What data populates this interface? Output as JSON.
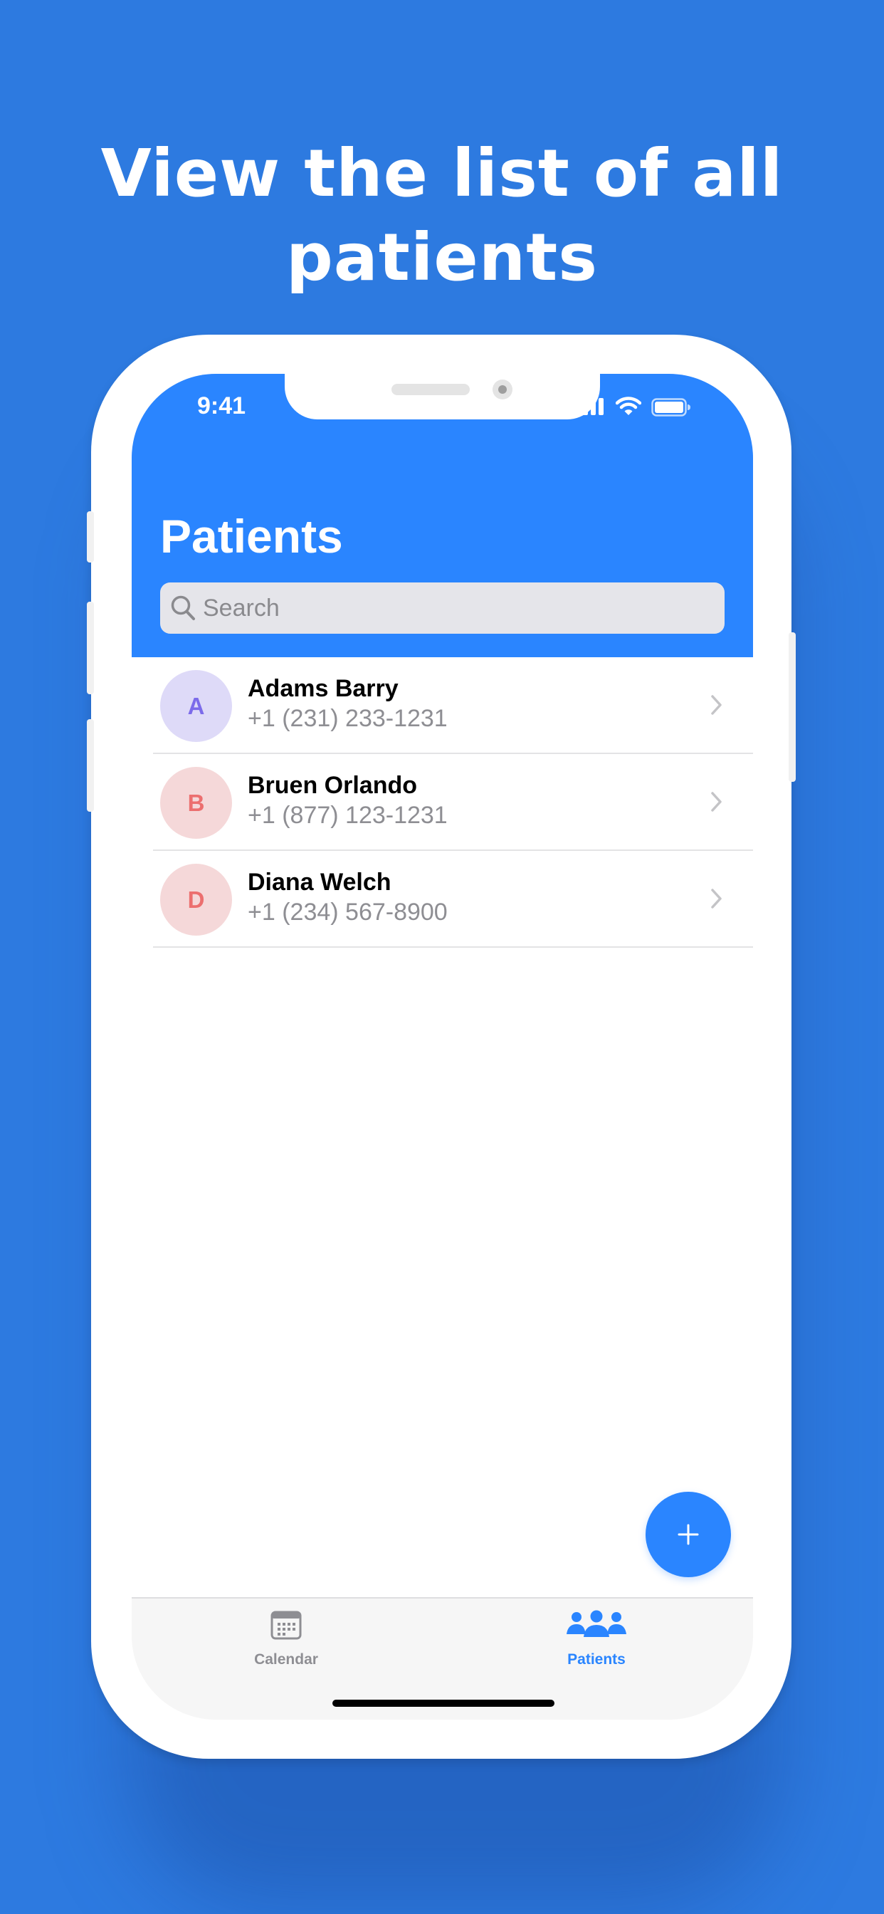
{
  "headline": {
    "line1": "View the list of all",
    "line2": "patients"
  },
  "status_bar": {
    "time": "9:41",
    "icons": [
      "cellular-signal-icon",
      "wifi-icon",
      "battery-icon"
    ]
  },
  "header": {
    "title": "Patients",
    "background_color": "#2a85ff"
  },
  "search": {
    "placeholder": "Search",
    "icon": "search-icon"
  },
  "patients": [
    {
      "initial": "A",
      "name": "Adams Barry",
      "phone": "+1 (231) 233-1231",
      "avatar_bg": "#dedaf8",
      "avatar_fg": "#7c6bea"
    },
    {
      "initial": "B",
      "name": "Bruen Orlando",
      "phone": "+1 (877) 123-1231",
      "avatar_bg": "#f5d8d9",
      "avatar_fg": "#ec6f6f"
    },
    {
      "initial": "D",
      "name": "Diana Welch",
      "phone": "+1 (234) 567-8900",
      "avatar_bg": "#f5d8d9",
      "avatar_fg": "#ec6f6f"
    }
  ],
  "fab": {
    "icon": "plus-icon",
    "color": "#2a85ff"
  },
  "tabs": [
    {
      "label": "Calendar",
      "icon": "calendar-icon",
      "active": false,
      "color": "#8e8e93"
    },
    {
      "label": "Patients",
      "icon": "people-icon",
      "active": true,
      "color": "#2a85ff"
    }
  ],
  "page_background": "#2d7ae0"
}
